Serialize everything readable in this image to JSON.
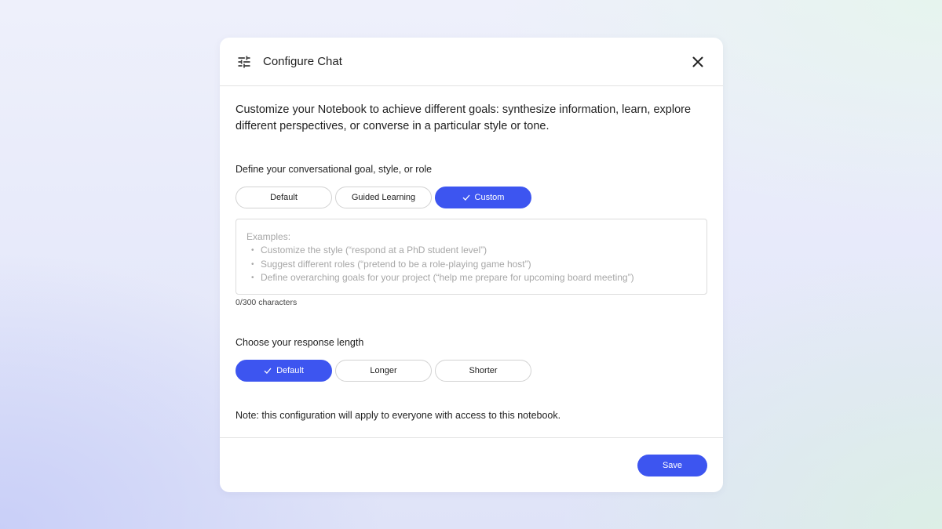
{
  "dialog": {
    "title": "Configure Chat",
    "header_icon": "tune-icon",
    "close_icon": "close-icon"
  },
  "intro": "Customize your Notebook to achieve different goals: synthesize information, learn, explore different perspectives, or converse in a particular style or tone.",
  "goal_section": {
    "label": "Define your conversational goal, style, or role",
    "options": [
      {
        "label": "Default",
        "selected": false
      },
      {
        "label": "Guided Learning",
        "selected": false
      },
      {
        "label": "Custom",
        "selected": true
      }
    ]
  },
  "custom_prompt": {
    "value": "",
    "placeholder_heading": "Examples:",
    "placeholder_items": [
      "Customize the style (“respond at a PhD student level”)",
      "Suggest different roles (“pretend to be a role-playing game host”)",
      "Define overarching goals for your project (“help me prepare for upcoming board meeting”)"
    ],
    "char_count": "0/300 characters"
  },
  "length_section": {
    "label": "Choose your response length",
    "options": [
      {
        "label": "Default",
        "selected": true
      },
      {
        "label": "Longer",
        "selected": false
      },
      {
        "label": "Shorter",
        "selected": false
      }
    ]
  },
  "note": "Note: this configuration will apply to everyone with access to this notebook.",
  "footer": {
    "save_label": "Save"
  },
  "colors": {
    "accent": "#3d55f0",
    "placeholder_text": "#a7a7a7",
    "divider": "#e3e3e3"
  }
}
